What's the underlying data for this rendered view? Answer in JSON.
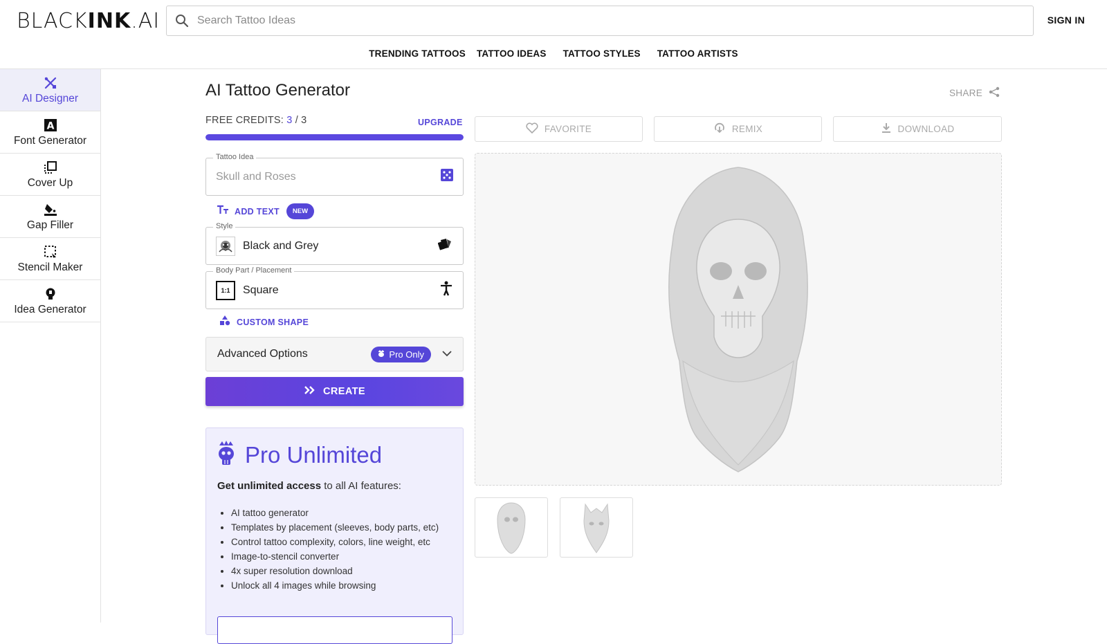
{
  "header": {
    "logo_light": "BLACK",
    "logo_bold": "INK",
    "logo_suffix": ".AI",
    "search_placeholder": "Search Tattoo Ideas",
    "sign_in": "SIGN IN",
    "nav": [
      "TRENDING TATTOOS",
      "TATTOO IDEAS",
      "TATTOO STYLES",
      "TATTOO ARTISTS"
    ]
  },
  "sidebar": {
    "items": [
      {
        "label": "AI Designer",
        "icon": "pencil-ruler-icon",
        "active": true
      },
      {
        "label": "Font Generator",
        "icon": "font-a-icon",
        "active": false
      },
      {
        "label": "Cover Up",
        "icon": "layers-icon",
        "active": false
      },
      {
        "label": "Gap Filler",
        "icon": "paint-bucket-icon",
        "active": false
      },
      {
        "label": "Stencil Maker",
        "icon": "stencil-icon",
        "active": false
      },
      {
        "label": "Idea Generator",
        "icon": "lightbulb-icon",
        "active": false
      }
    ]
  },
  "main": {
    "title": "AI Tattoo Generator",
    "credits_label": "FREE CREDITS:",
    "credits_used": "3",
    "credits_sep": " / ",
    "credits_total": "3",
    "credits_fraction": 1.0,
    "upgrade": "UPGRADE",
    "tattoo_idea": {
      "legend": "Tattoo Idea",
      "placeholder": "Skull and Roses",
      "icon": "dice-icon"
    },
    "add_text": "ADD TEXT",
    "new_badge": "NEW",
    "style": {
      "legend": "Style",
      "value": "Black and Grey",
      "icon": "palette-swatch-icon"
    },
    "body_part": {
      "legend": "Body Part / Placement",
      "value": "Square",
      "thumb_text": "1:1",
      "icon": "body-icon"
    },
    "custom_shape": "CUSTOM SHAPE",
    "advanced": "Advanced Options",
    "pro_only": "Pro Only",
    "create": "CREATE"
  },
  "pro_card": {
    "title": "Pro Unlimited",
    "lead_bold": "Get unlimited access",
    "lead_rest": " to all AI features:",
    "features": [
      "AI tattoo generator",
      "Templates by placement (sleeves, body parts, etc)",
      "Control tattoo complexity, colors, line weight, etc",
      "Image-to-stencil converter",
      "4x super resolution download",
      "Unlock all 4 images while browsing"
    ]
  },
  "preview": {
    "share": "SHARE",
    "favorite": "FAVORITE",
    "remix": "REMIX",
    "download": "DOWNLOAD"
  },
  "colors": {
    "accent": "#5546d8",
    "active_bg": "#eeeef9",
    "pro_card_bg": "#f0effd"
  }
}
